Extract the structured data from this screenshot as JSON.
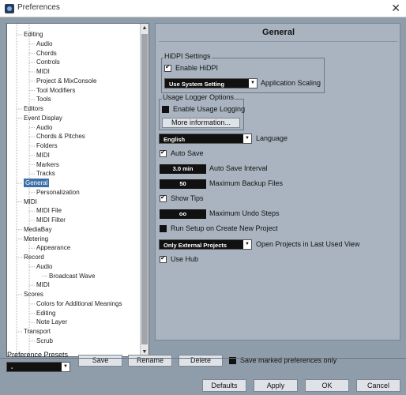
{
  "window": {
    "title": "Preferences",
    "close_glyph": "✕"
  },
  "panel_title": "General",
  "tree": [
    {
      "label": "Editing",
      "level": 1
    },
    {
      "label": "Audio",
      "level": 2
    },
    {
      "label": "Chords",
      "level": 2
    },
    {
      "label": "Controls",
      "level": 2
    },
    {
      "label": "MIDI",
      "level": 2
    },
    {
      "label": "Project & MixConsole",
      "level": 2
    },
    {
      "label": "Tool Modifiers",
      "level": 2
    },
    {
      "label": "Tools",
      "level": 2
    },
    {
      "label": "Editors",
      "level": 1
    },
    {
      "label": "Event Display",
      "level": 1
    },
    {
      "label": "Audio",
      "level": 2
    },
    {
      "label": "Chords & Pitches",
      "level": 2
    },
    {
      "label": "Folders",
      "level": 2
    },
    {
      "label": "MIDI",
      "level": 2
    },
    {
      "label": "Markers",
      "level": 2
    },
    {
      "label": "Tracks",
      "level": 2
    },
    {
      "label": "General",
      "level": 1,
      "selected": true
    },
    {
      "label": "Personalization",
      "level": 2
    },
    {
      "label": "MIDI",
      "level": 1
    },
    {
      "label": "MIDI File",
      "level": 2
    },
    {
      "label": "MIDI Filter",
      "level": 2
    },
    {
      "label": "MediaBay",
      "level": 1
    },
    {
      "label": "Metering",
      "level": 1
    },
    {
      "label": "Appearance",
      "level": 2
    },
    {
      "label": "Record",
      "level": 1
    },
    {
      "label": "Audio",
      "level": 2
    },
    {
      "label": "Broadcast Wave",
      "level": 3
    },
    {
      "label": "MIDI",
      "level": 2
    },
    {
      "label": "Scores",
      "level": 1
    },
    {
      "label": "Colors for Additional Meanings",
      "level": 2
    },
    {
      "label": "Editing",
      "level": 2
    },
    {
      "label": "Note Layer",
      "level": 2
    },
    {
      "label": "Transport",
      "level": 1
    },
    {
      "label": "Scrub",
      "level": 2
    }
  ],
  "hidpi": {
    "group_label": "HiDPI Settings",
    "enable_label": "Enable HiDPI",
    "enable_checked": true,
    "scaling_value": "Use System Setting",
    "scaling_label": "Application Scaling"
  },
  "usage_logger": {
    "group_label": "Usage Logger Options",
    "enable_label": "Enable Usage Logging",
    "enable_checked": false,
    "more_info_label": "More information..."
  },
  "language": {
    "value": "English",
    "label": "Language"
  },
  "auto_save": {
    "label": "Auto Save",
    "checked": true
  },
  "auto_save_interval": {
    "value": "3.0 min",
    "label": "Auto Save Interval"
  },
  "max_backup": {
    "value": "50",
    "label": "Maximum Backup Files"
  },
  "show_tips": {
    "label": "Show Tips",
    "checked": true
  },
  "max_undo": {
    "value": "oo",
    "label": "Maximum Undo Steps"
  },
  "run_setup": {
    "label": "Run Setup on Create New Project",
    "checked": false
  },
  "open_projects": {
    "value": "Only External Projects",
    "label": "Open Projects in Last Used View"
  },
  "use_hub": {
    "label": "Use Hub",
    "checked": true
  },
  "presets": {
    "label": "Preference Presets",
    "value": "-",
    "save_label": "Save",
    "rename_label": "Rename",
    "delete_label": "Delete",
    "marked_only_label": "Save marked preferences only",
    "marked_only_checked": false
  },
  "footer": {
    "defaults_label": "Defaults",
    "apply_label": "Apply",
    "ok_label": "OK",
    "cancel_label": "Cancel"
  },
  "icons": {
    "dropdown_arrow": "▼",
    "scroll_up": "▲",
    "scroll_down": "▼"
  }
}
